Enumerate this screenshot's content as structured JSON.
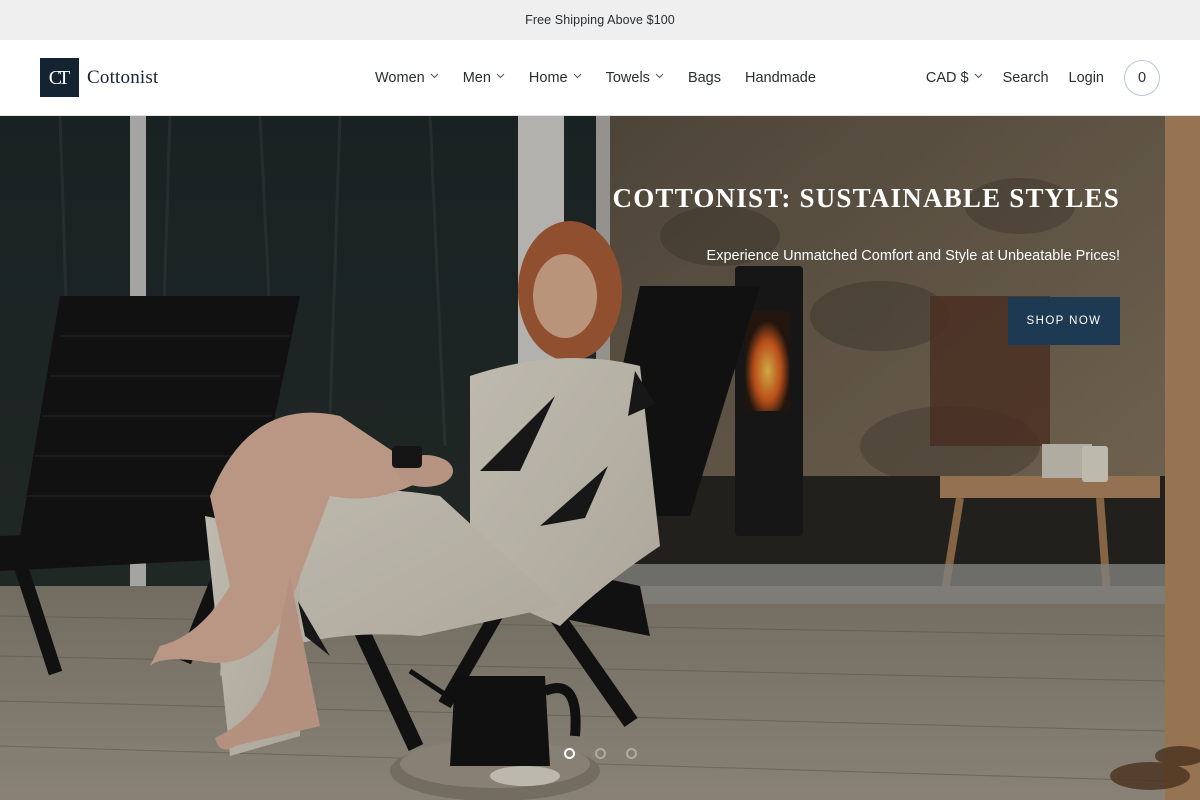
{
  "announcement": {
    "text": "Free Shipping Above $100"
  },
  "brand": {
    "name": "Cottonist",
    "mark": "CT"
  },
  "nav": {
    "items": [
      {
        "label": "Women",
        "has_dropdown": true
      },
      {
        "label": "Men",
        "has_dropdown": true
      },
      {
        "label": "Home",
        "has_dropdown": true
      },
      {
        "label": "Towels",
        "has_dropdown": true
      },
      {
        "label": "Bags",
        "has_dropdown": false
      },
      {
        "label": "Handmade",
        "has_dropdown": false
      }
    ]
  },
  "utility": {
    "currency": "CAD $",
    "search": "Search",
    "login": "Login",
    "cart_count": "0"
  },
  "hero": {
    "title": "COTTONIST: SUSTAINABLE STYLES",
    "subtitle": "Experience Unmatched Comfort and Style at Unbeatable Prices!",
    "cta": "SHOP NOW",
    "slides": 3,
    "active_slide": 1
  },
  "icons": {
    "dropdown": "chevron-down-icon"
  },
  "colors": {
    "announcement_bg": "#efefef",
    "brand_navy": "#142331",
    "cta_bg": "#1e3a52",
    "text": "#2a2d31"
  }
}
